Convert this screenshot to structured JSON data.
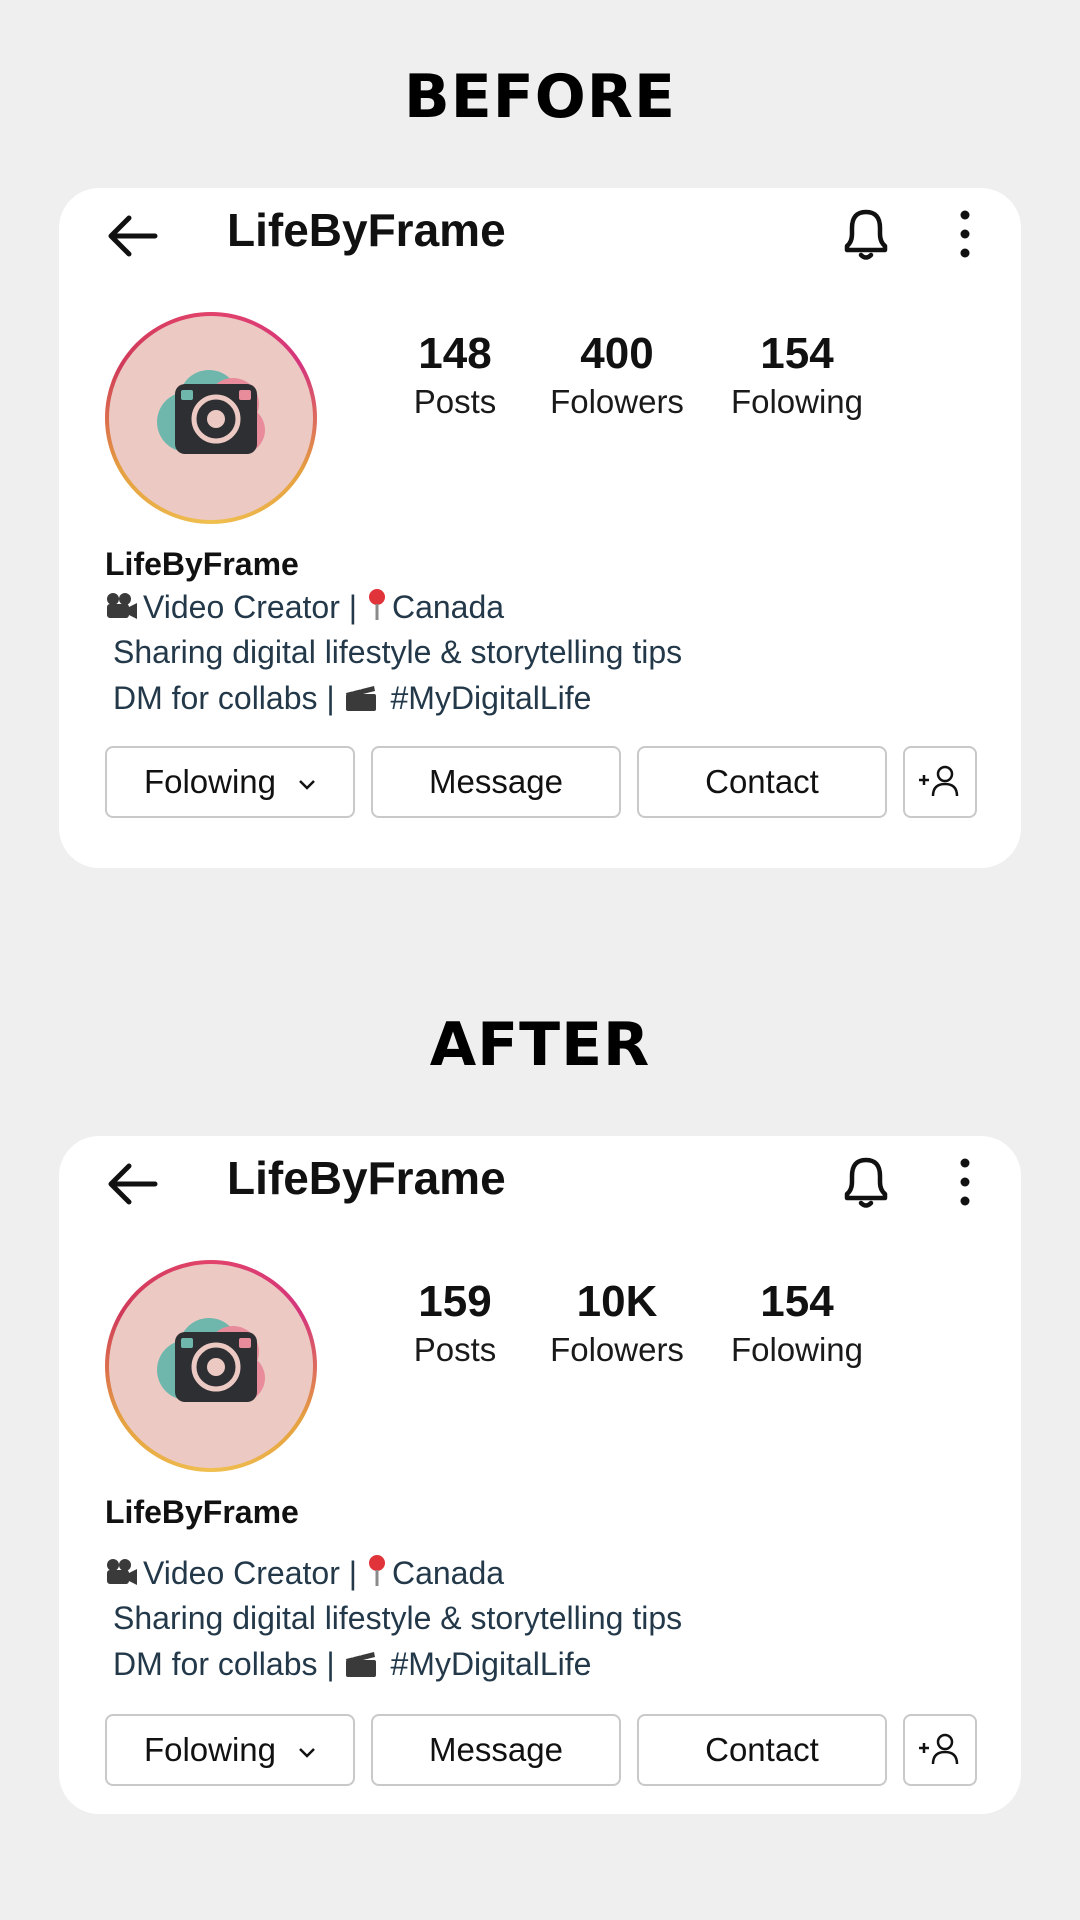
{
  "before": {
    "section_title": "BEFORE",
    "handle": "LifeByFrame",
    "stats": {
      "posts_count": "148",
      "posts_label": "Posts",
      "followers_count": "400",
      "followers_label": "Folowers",
      "following_count": "154",
      "following_label": "Folowing"
    },
    "bio": {
      "name": "LifeByFrame",
      "line1_a": "Video Creator | ",
      "line1_b": "Canada",
      "line2": "Sharing digital lifestyle & storytelling tips",
      "line3_a": "DM for collabs | ",
      "line3_b": " #MyDigitalLife"
    },
    "buttons": {
      "following": "Folowing",
      "message": "Message",
      "contact": "Contact"
    }
  },
  "after": {
    "section_title": "AFTER",
    "handle": "LifeByFrame",
    "stats": {
      "posts_count": "159",
      "posts_label": "Posts",
      "followers_count": "10K",
      "followers_label": "Folowers",
      "following_count": "154",
      "following_label": "Folowing"
    },
    "bio": {
      "name": "LifeByFrame",
      "line1_a": "Video Creator | ",
      "line1_b": "Canada",
      "line2": "Sharing digital lifestyle & storytelling tips",
      "line3_a": "DM for collabs | ",
      "line3_b": " #MyDigitalLife"
    },
    "buttons": {
      "following": "Folowing",
      "message": "Message",
      "contact": "Contact"
    }
  },
  "icons": {
    "back": "arrow-left-icon",
    "bell": "bell-icon",
    "more": "more-vertical-icon",
    "camera": "camera-icon",
    "add_user": "add-user-icon"
  },
  "colors": {
    "background": "#efefef",
    "card": "#ffffff",
    "bio_text": "#23394a",
    "avatar_fill": "#ecc9c3",
    "button_border": "#c9c9c9"
  }
}
